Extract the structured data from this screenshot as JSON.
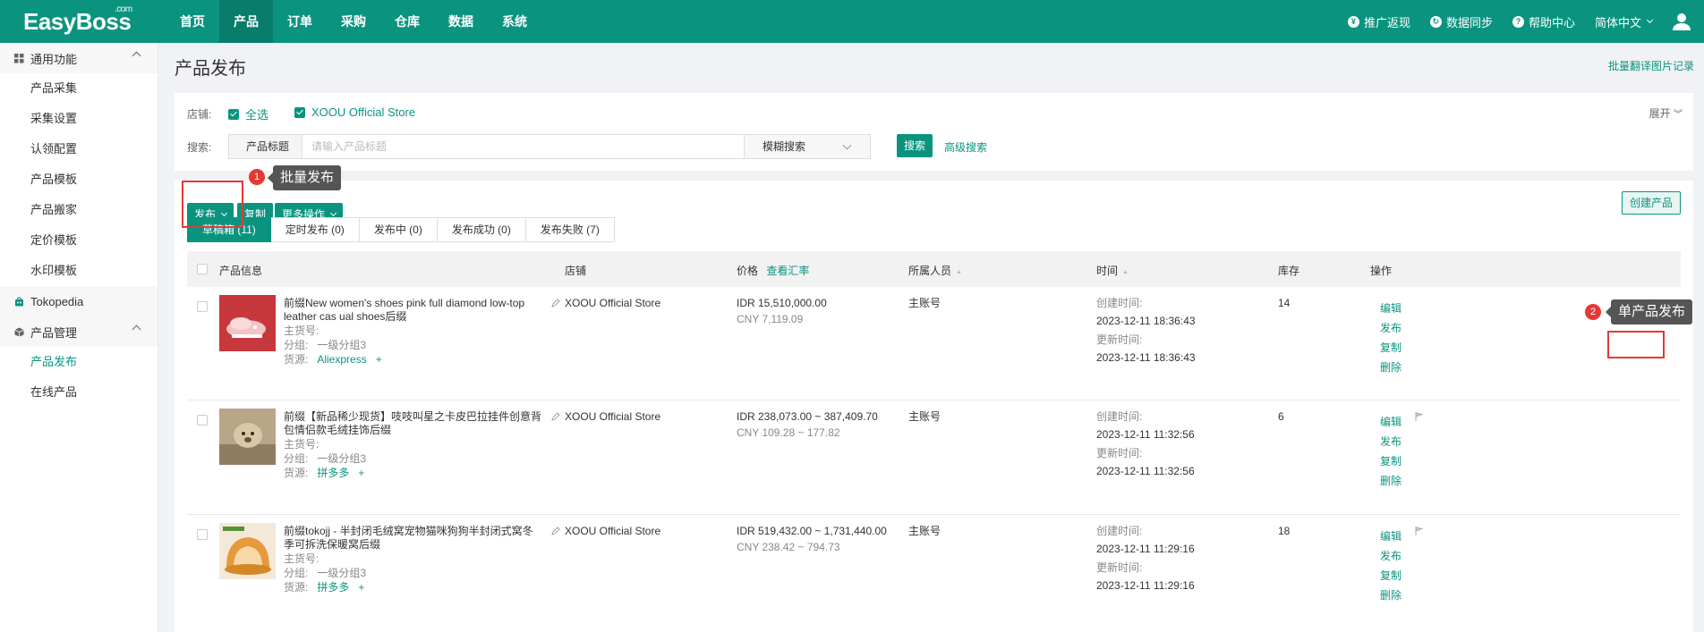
{
  "topbar": {
    "logo": "EasyBoss",
    "logo_sup": ".com",
    "nav": [
      "首页",
      "产品",
      "订单",
      "采购",
      "仓库",
      "数据",
      "系统"
    ],
    "active_nav": 1,
    "right": {
      "promo": "推广返现",
      "sync": "数据同步",
      "help": "帮助中心",
      "lang": "简体中文"
    }
  },
  "sidebar": {
    "group1": "通用功能",
    "group1_items": [
      "产品采集",
      "采集设置",
      "认领配置",
      "产品模板",
      "产品搬家",
      "定价模板",
      "水印模板"
    ],
    "group2": "Tokopedia",
    "group3": "产品管理",
    "group3_items": [
      "产品发布",
      "在线产品"
    ],
    "active_item": "产品发布"
  },
  "page": {
    "title": "产品发布",
    "batch_translate_link": "批量翻译图片记录"
  },
  "filter": {
    "store_label": "店铺:",
    "select_all": "全选",
    "store_name": "XOOU Official Store",
    "expand": "展开",
    "search_label": "搜索:",
    "search_type": "产品标题",
    "search_placeholder": "请输入产品标题",
    "search_mode": "模糊搜索",
    "search_button": "搜索",
    "advanced_search": "高级搜索"
  },
  "toolbar": {
    "publish": "发布",
    "copy": "复制",
    "more": "更多操作",
    "create": "创建产品"
  },
  "tabs": [
    {
      "label": "草稿箱 (11)"
    },
    {
      "label": "定时发布 (0)"
    },
    {
      "label": "发布中 (0)"
    },
    {
      "label": "发布成功 (0)"
    },
    {
      "label": "发布失败 (7)"
    }
  ],
  "table": {
    "headers": {
      "product": "产品信息",
      "store": "店铺",
      "price": "价格",
      "exchange": "查看汇率",
      "owner": "所属人员",
      "time": "时间",
      "stock": "库存",
      "ops": "操作"
    },
    "meta_labels": {
      "sku": "主货号:",
      "group": "分组:",
      "source": "货源:"
    },
    "time_labels": {
      "created": "创建时间:",
      "updated": "更新时间:"
    },
    "rows": [
      {
        "name": "前缀New women's shoes pink full diamond low-top leather cas ual shoes后缀",
        "group": "一级分组3",
        "source": "Aliexpress",
        "store": "XOOU Official Store",
        "price_idr": "IDR 15,510,000.00",
        "price_cny": "CNY 7,119.09",
        "owner": "主账号",
        "created": "2023-12-11 18:36:43",
        "updated": "2023-12-11 18:36:43",
        "stock": "14",
        "actions": [
          "编辑",
          "发布",
          "复制",
          "删除"
        ]
      },
      {
        "name": "前缀【新品稀少现货】吱吱叫星之卡皮巴拉挂件创意背包情侣款毛绒挂饰后缀",
        "group": "一级分组3",
        "source": "拼多多",
        "store": "XOOU Official Store",
        "price_idr": "IDR 238,073.00 ~ 387,409.70",
        "price_cny": "CNY 109.28 ~ 177.82",
        "owner": "主账号",
        "created": "2023-12-11 11:32:56",
        "updated": "2023-12-11 11:32:56",
        "stock": "6",
        "actions": [
          "编辑",
          "发布",
          "复制",
          "删除"
        ]
      },
      {
        "name": "前缀tokojj - 半封闭毛绒窝宠物猫咪狗狗半封闭式窝冬季可拆洗保暖窝后缀",
        "group": "一级分组3",
        "source": "拼多多",
        "store": "XOOU Official Store",
        "price_idr": "IDR 519,432.00 ~ 1,731,440.00",
        "price_cny": "CNY 238.42 ~ 794.73",
        "owner": "主账号",
        "created": "2023-12-11 11:29:16",
        "updated": "2023-12-11 11:29:16",
        "stock": "18",
        "actions": [
          "编辑",
          "发布",
          "复制",
          "删除"
        ]
      }
    ]
  },
  "annotations": {
    "a1_num": "1",
    "a1_text": "批量发布",
    "a2_num": "2",
    "a2_text": "单产品发布"
  },
  "colors": {
    "brand": "#0a9480",
    "annotation": "#e53935"
  }
}
